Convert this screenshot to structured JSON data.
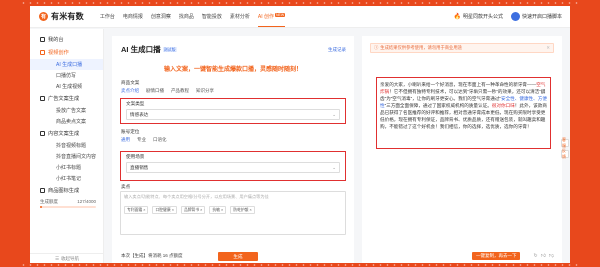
{
  "brand": {
    "logo_mark": "有",
    "name": "有米有数"
  },
  "nav": {
    "items": [
      {
        "label": "工作台"
      },
      {
        "label": "电商情报"
      },
      {
        "label": "创意洞察"
      },
      {
        "label": "找商品"
      },
      {
        "label": "智能投放"
      },
      {
        "label": "素材分析"
      },
      {
        "label": "AI 创作",
        "badge": "NEW",
        "active": true
      }
    ],
    "right": [
      {
        "label": "明星同款开头公式",
        "icon": "flame-icon"
      },
      {
        "label": "快速开启口播脚本",
        "icon": "avatar-icon"
      }
    ]
  },
  "sidebar": {
    "home": "我的台",
    "groups": [
      {
        "label": "视频创作",
        "active": true,
        "items": [
          {
            "label": "AI 生成口播",
            "active": true
          },
          {
            "label": "口播仿写"
          },
          {
            "label": "AI 生成视频"
          }
        ]
      },
      {
        "label": "广告文案生成",
        "items": [
          {
            "label": "投放广告文案"
          },
          {
            "label": "商品卖点文案"
          }
        ]
      },
      {
        "label": "内容文案生成",
        "items": [
          {
            "label": "抖音视频标题"
          },
          {
            "label": "抖音直播间文内容"
          },
          {
            "label": "小红书标题"
          },
          {
            "label": "小红书笔记"
          }
        ]
      },
      {
        "label": "商品图标生成",
        "items": []
      }
    ],
    "quota": {
      "label": "生成额度",
      "value_text": "127/4000",
      "fraction": 0.032
    },
    "bottom": "收起导航"
  },
  "middle": {
    "title": "AI 生成口播",
    "title_badge": "测试版",
    "link": "生成记录",
    "slogan": "输入文案，一键智能生成爆款口播，灵感随时随刻！",
    "type_label": "商品文案",
    "type_chips": [
      "卖点介绍",
      "剧情口播",
      "产品教程",
      "知识分享"
    ],
    "copy_type_label": "文案类型",
    "copy_type_value": "情感表达",
    "account_label": "账号定位",
    "account_chips": [
      "通用",
      "专业",
      "口语化"
    ],
    "scene_label": "使用场景",
    "scene_value": "直播销售",
    "textarea_label": "卖点",
    "textarea_placeholder": "输入卖点/功能特点、每个卖点用空格/分号分开，以应用场景、用户痛点等为佳",
    "tags": [
      "专利面霜 ×",
      "口腔健康 ×",
      "品牌背书 ×",
      "抗敏 ×",
      "防蛀护龈 ×"
    ],
    "footer_text": "本次【生成】将消耗 16 点额度",
    "generate_label": "生成"
  },
  "right": {
    "notice": "生成结果仅供参考使用，请勿用于商业用途",
    "result_pre": "亲爱的大家，小喇叭来给一个好消息，现在市面上有一种革命性的新牙膏——",
    "result_red1": "空气炸锅",
    "result_mid1": "！它不但拥有独特专利技术，可以达到“牙垢只需一秒”的效果，还可以清洁“龋齿”为“空气消毒”，让你的刷牙更安心。我们的空气牙膏通过“",
    "result_blue1": "安全性、健康性、方便性",
    "result_mid2": "”三方面全面保障，通过了国家权威机构的质量认证。",
    "result_red2": "很对你口味",
    "result_mid3": "！此外，该款商品已获得了名医推荐的好评和推荐，相对普通牙膏成本更低，现在购买限时享受更低价格，现在拥有专利保证，品牌背书、优质品质，还有赠送包装，就叫趣卖和趣购，不能错过了这个好机会！",
    "result_end": "我们相信，你的选择，选优质，选你的牙膏！",
    "copy_label": "一键复制，再去一下",
    "foot_icons": [
      "refresh-icon",
      "like-icon",
      "dislike-icon"
    ]
  },
  "side_tools": [
    "客服",
    "反馈"
  ]
}
